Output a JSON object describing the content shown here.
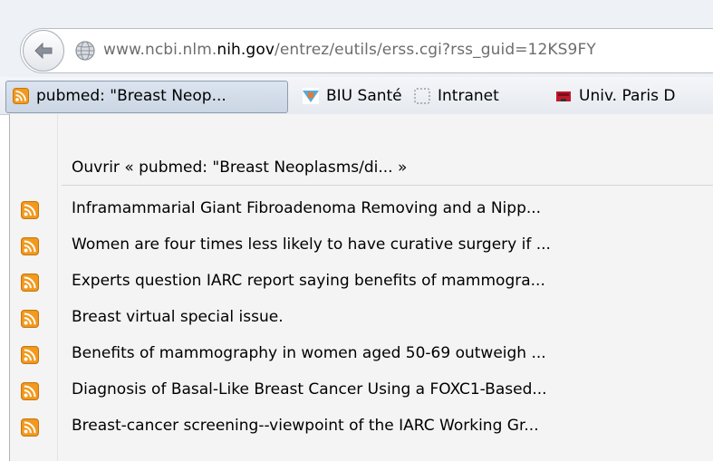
{
  "url": {
    "prefix": "www.ncbi.nlm.",
    "host": "nih.gov",
    "path": "/entrez/eutils/erss.cgi?rss_guid=12KS9FY"
  },
  "bookmarks": [
    {
      "label": "pubmed: \"Breast Neop...",
      "icon": "rss-feed-icon"
    },
    {
      "label": "BIU Santé",
      "icon": "biu-sante-favicon"
    },
    {
      "label": "Intranet",
      "icon": "dotted-square-icon"
    },
    {
      "label": "Univ. Paris D",
      "icon": "univ-paris-favicon"
    }
  ],
  "menu": {
    "open_label": "Ouvrir « pubmed: \"Breast Neoplasms/di... »",
    "items": [
      {
        "label": "Inframammarial Giant Fibroadenoma Removing and a Nipp..."
      },
      {
        "label": "Women are four times less likely to have curative surgery if ..."
      },
      {
        "label": "Experts question IARC report saying benefits of mammogra..."
      },
      {
        "label": "Breast virtual special issue."
      },
      {
        "label": "Benefits of mammography in women aged 50-69 outweigh ..."
      },
      {
        "label": "Diagnosis of Basal-Like Breast Cancer Using a FOXC1-Based..."
      },
      {
        "label": "Breast-cancer screening--viewpoint of the IARC Working Gr..."
      }
    ]
  },
  "colors": {
    "rss_orange": "#f29a1e",
    "menu_bg": "#f4f4f4",
    "active_bookmark": "#d3dde9"
  }
}
